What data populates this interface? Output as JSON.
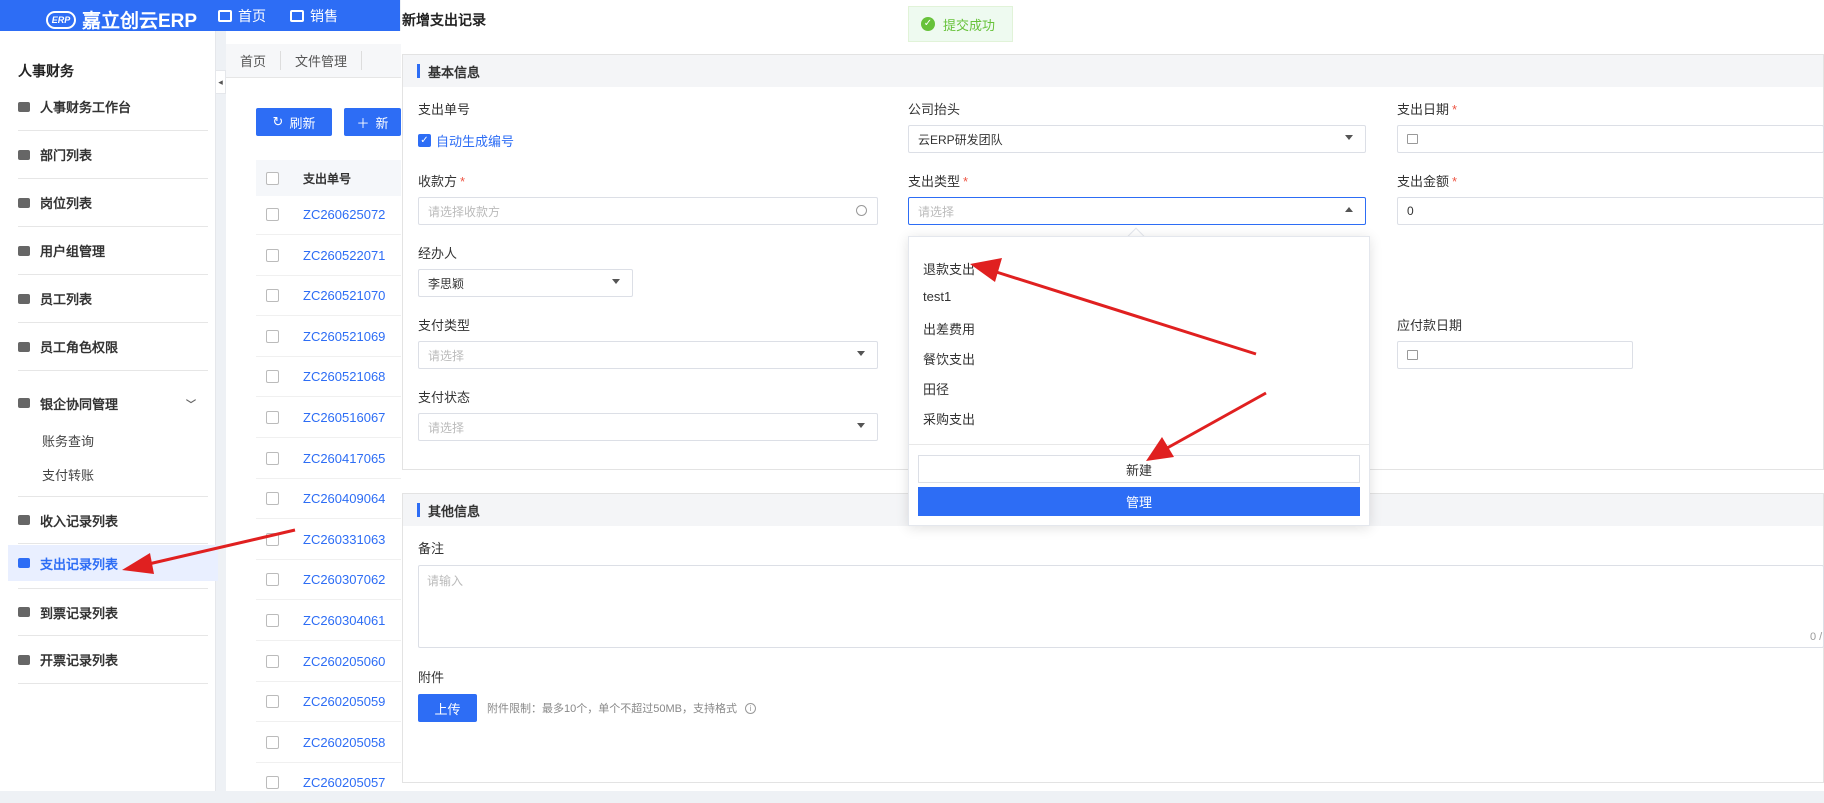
{
  "app": {
    "brand": "嘉立创云ERP",
    "logo_mark": "ERP"
  },
  "topnav": [
    {
      "label": "首页"
    },
    {
      "label": "销售"
    }
  ],
  "sidebar": {
    "section_title": "人事财务",
    "items": [
      {
        "label": "人事财务工作台"
      },
      {
        "label": "部门列表"
      },
      {
        "label": "岗位列表"
      },
      {
        "label": "用户组管理"
      },
      {
        "label": "员工列表"
      },
      {
        "label": "员工角色权限"
      },
      {
        "label": "银企协同管理"
      },
      {
        "label": "收入记录列表"
      },
      {
        "label": "支出记录列表"
      },
      {
        "label": "到票记录列表"
      },
      {
        "label": "开票记录列表"
      }
    ],
    "subitems": [
      {
        "label": "账务查询"
      },
      {
        "label": "支付转账"
      }
    ]
  },
  "tabs": [
    {
      "label": "首页"
    },
    {
      "label": "文件管理"
    }
  ],
  "toolbar": {
    "refresh_label": "刷新",
    "add_label": "新"
  },
  "table": {
    "header": "支出单号",
    "rows": [
      "ZC260625072",
      "ZC260522071",
      "ZC260521070",
      "ZC260521069",
      "ZC260521068",
      "ZC260516067",
      "ZC260417065",
      "ZC260409064",
      "ZC260331063",
      "ZC260307062",
      "ZC260304061",
      "ZC260205060",
      "ZC260205059",
      "ZC260205058",
      "ZC260205057"
    ]
  },
  "modal": {
    "title": "新增支出记录",
    "toast": "提交成功",
    "basic_section": "基本信息",
    "other_section": "其他信息",
    "fields": {
      "order_no_label": "支出单号",
      "auto_gen_label": "自动生成编号",
      "company_label": "公司抬头",
      "company_value": "云ERP研发团队",
      "date_label": "支出日期",
      "payee_label": "收款方",
      "payee_placeholder": "请选择收款方",
      "type_label": "支出类型",
      "type_placeholder": "请选择",
      "amount_label": "支出金额",
      "amount_value": "0",
      "handler_label": "经办人",
      "handler_value": "李思颖",
      "pay_type_label": "支付类型",
      "pay_type_placeholder": "请选择",
      "due_date_label": "应付款日期",
      "pay_status_label": "支付状态",
      "pay_status_placeholder": "请选择",
      "remark_label": "备注",
      "remark_placeholder": "请输入",
      "remark_counter": "0 /",
      "attach_label": "附件",
      "upload_label": "上传",
      "attach_hint": "附件限制：最多10个，单个不超过50MB，支持格式"
    },
    "dropdown": {
      "options": [
        "退款支出",
        "test1",
        "出差费用",
        "餐饮支出",
        "田径",
        "采购支出"
      ],
      "new_label": "新建",
      "manage_label": "管理"
    }
  },
  "colors": {
    "primary": "#2d6df5",
    "annotation_arrow": "#e02020",
    "success": "#67c23a"
  }
}
